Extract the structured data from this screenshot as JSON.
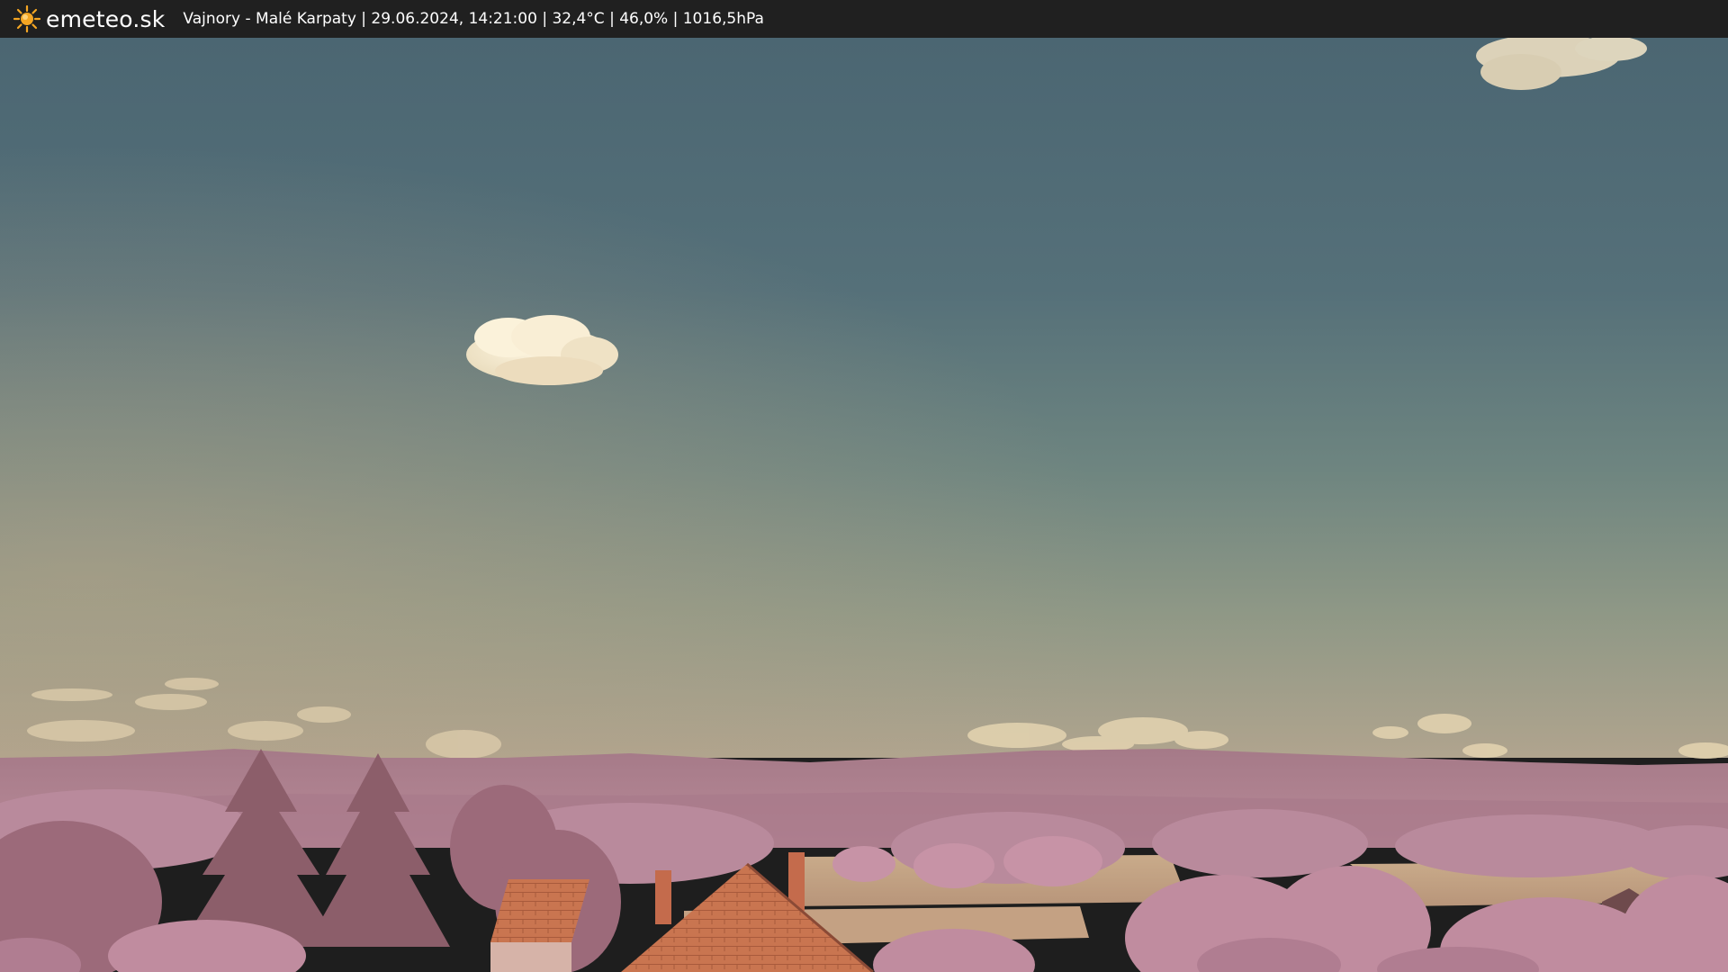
{
  "header": {
    "brand": "emeteo.sk",
    "logo_icon": "sun-icon",
    "caption": "Vajnory - Malé Karpaty | 29.06.2024, 14:21:00 | 32,4°C | 46,0% | 1016,5hPa"
  },
  "colors": {
    "bar_background": "#202020",
    "sun": "#f5a623",
    "sky_top": "#4a6570",
    "sky_horizon": "#9a9e88",
    "foliage": "#b47a8c",
    "roof": "#c8704e"
  }
}
